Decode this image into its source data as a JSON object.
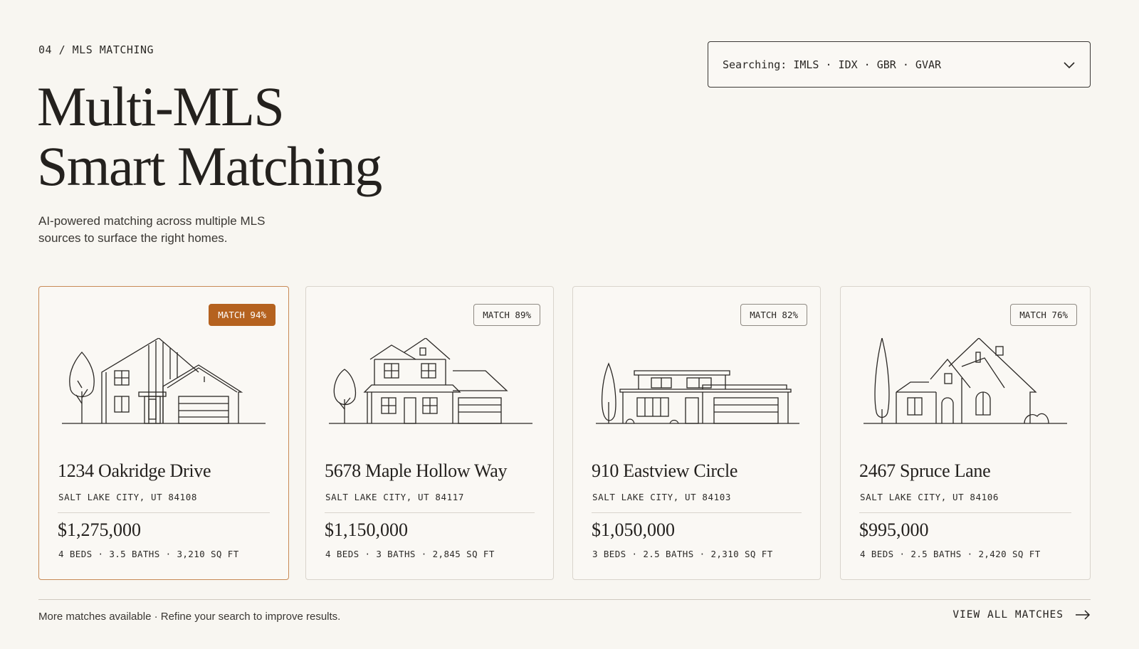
{
  "header": {
    "eyebrow": "04 / MLS MATCHING",
    "title_line1": "Multi-MLS",
    "title_line2": "Smart Matching",
    "subtitle": "AI-powered matching across multiple MLS sources to surface the right homes."
  },
  "mls_selector": {
    "label": "Searching: IMLS · IDX · GBR · GVAR",
    "icon": "chevron-down-icon"
  },
  "listings": [
    {
      "match": "MATCH 94%",
      "address": "1234 Oakridge Drive",
      "city": "SALT LAKE CITY, UT 84108",
      "price": "$1,275,000",
      "specs": "4 BEDS · 3.5 BATHS · 3,210 SQ FT",
      "highlighted": true
    },
    {
      "match": "MATCH 89%",
      "address": "5678 Maple Hollow Way",
      "city": "SALT LAKE CITY, UT 84117",
      "price": "$1,150,000",
      "specs": "4 BEDS · 3 BATHS · 2,845 SQ FT",
      "highlighted": false
    },
    {
      "match": "MATCH 82%",
      "address": "910 Eastview Circle",
      "city": "SALT LAKE CITY, UT 84103",
      "price": "$1,050,000",
      "specs": "3 BEDS · 2.5 BATHS · 2,310 SQ FT",
      "highlighted": false
    },
    {
      "match": "MATCH 76%",
      "address": "2467 Spruce Lane",
      "city": "SALT LAKE CITY, UT 84106",
      "price": "$995,000",
      "specs": "4 BEDS · 2.5 BATHS · 2,420 SQ FT",
      "highlighted": false
    }
  ],
  "footer": {
    "note": "More matches available · Refine your search to improve results.",
    "view_all": "VIEW ALL MATCHES",
    "icon": "arrow-right-icon"
  },
  "colors": {
    "background": "#f8f6f1",
    "accent": "#b5621f",
    "text": "#24211e"
  }
}
